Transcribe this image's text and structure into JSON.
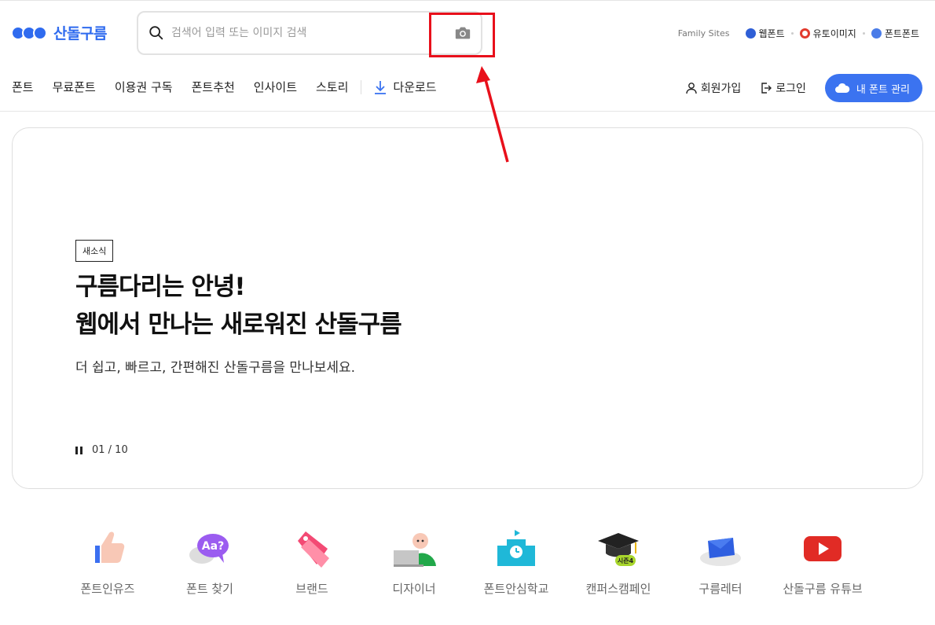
{
  "logo": {
    "text": "산돌구름"
  },
  "search": {
    "placeholder": "검색어 입력 또는 이미지 검색"
  },
  "family_sites": {
    "label": "Family Sites",
    "items": [
      {
        "label": "웹폰트",
        "color": "#2f5fd6"
      },
      {
        "label": "유토이미지",
        "color": "#e23b2e"
      },
      {
        "label": "폰트폰트",
        "color": "#4a7ce8"
      }
    ]
  },
  "nav": {
    "items": [
      "폰트",
      "무료폰트",
      "이용권 구독",
      "폰트추천",
      "인사이트",
      "스토리"
    ],
    "download": "다운로드"
  },
  "account": {
    "signup": "회원가입",
    "login": "로그인",
    "my_fonts": "내 폰트 관리"
  },
  "hero": {
    "badge": "새소식",
    "title_line1": "구름다리는 안녕!",
    "title_line2": "웹에서 만나는 새로워진 산돌구름",
    "subtitle": "더 쉽고, 빠르고, 간편해진 산돌구름을 만나보세요.",
    "pager": "01 / 10"
  },
  "quick_links": [
    {
      "label": "폰트인유즈",
      "icon": "thumbs-up-icon"
    },
    {
      "label": "폰트 찾기",
      "icon": "speech-bubble-icon",
      "icon_text": "Aa?"
    },
    {
      "label": "브랜드",
      "icon": "tag-icon"
    },
    {
      "label": "디자이너",
      "icon": "designer-icon"
    },
    {
      "label": "폰트안심학교",
      "icon": "school-icon"
    },
    {
      "label": "캔퍼스캠페인",
      "icon": "graduation-cap-icon",
      "icon_text": "시즌4"
    },
    {
      "label": "구름레터",
      "icon": "cloud-letter-icon"
    },
    {
      "label": "산돌구름 유튜브",
      "icon": "youtube-icon"
    }
  ],
  "colors": {
    "brand": "#2f6bef",
    "button": "#3b73f0",
    "annotation": "#e8101b"
  }
}
